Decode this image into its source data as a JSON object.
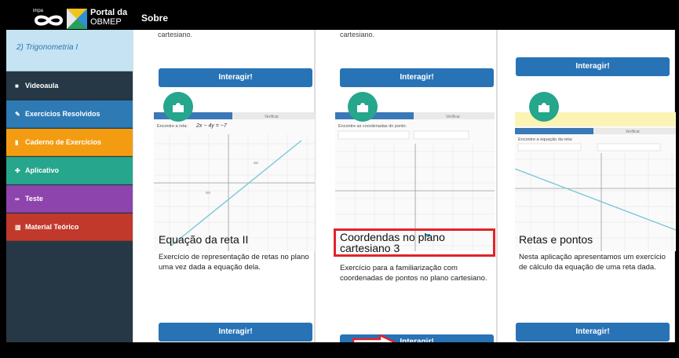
{
  "header": {
    "logo_small": "impa",
    "logo_line1": "Portal da",
    "logo_line2": "OBMEP",
    "nav_sobre": "Sobre"
  },
  "sidebar": {
    "topic": "2) Trigonometria I",
    "items": [
      {
        "label": "Videoaula",
        "icon": "video-icon",
        "color": "#263845"
      },
      {
        "label": "Exercícios Resolvidos",
        "icon": "edit-icon",
        "color": "#2d7ab4"
      },
      {
        "label": "Caderno de Exercícios",
        "icon": "book-icon",
        "color": "#f39c12"
      },
      {
        "label": "Aplicativo",
        "icon": "puzzle-icon",
        "color": "#26a68c"
      },
      {
        "label": "Teste",
        "icon": "glasses-icon",
        "color": "#8e44ad"
      },
      {
        "label": "Material Teórico",
        "icon": "open-book-icon",
        "color": "#c0392b"
      }
    ]
  },
  "cards_top": [
    {
      "snippet": "cartesiano.",
      "button": "Interagir!"
    },
    {
      "snippet": "cartesiano.",
      "button": "Interagir!"
    },
    {
      "snippet": "",
      "button": "Interagir!"
    }
  ],
  "cards": [
    {
      "title": "Equação da reta II",
      "desc": "Exercício de representação de retas no plano uma vez dada a equação dela.",
      "button": "Interagir!",
      "thumb_tab1": "",
      "thumb_tab2": "Verificar",
      "thumb_prompt": "Encontre a reta:",
      "thumb_eq": "2x − 4y = −7"
    },
    {
      "title": "Coordendas no plano cartesiano 3",
      "desc": "Exercício para a familiarização com coordenadas de pontos no plano cartesiano.",
      "button": "Interagir!",
      "thumb_tab1": "",
      "thumb_tab2": "Verificar",
      "thumb_prompt": "Encontre as coordenadas do ponto:"
    },
    {
      "title": "Retas e pontos",
      "desc": "Nesta aplicação apresentamos um exercício de cálculo da equação de uma reta dada.",
      "button": "Interagir!",
      "thumb_tab1": "",
      "thumb_tab2": "Verificar",
      "thumb_prompt": "Encontre a equação da reta:"
    }
  ],
  "annotation": {
    "highlight_color": "#e0242a"
  }
}
